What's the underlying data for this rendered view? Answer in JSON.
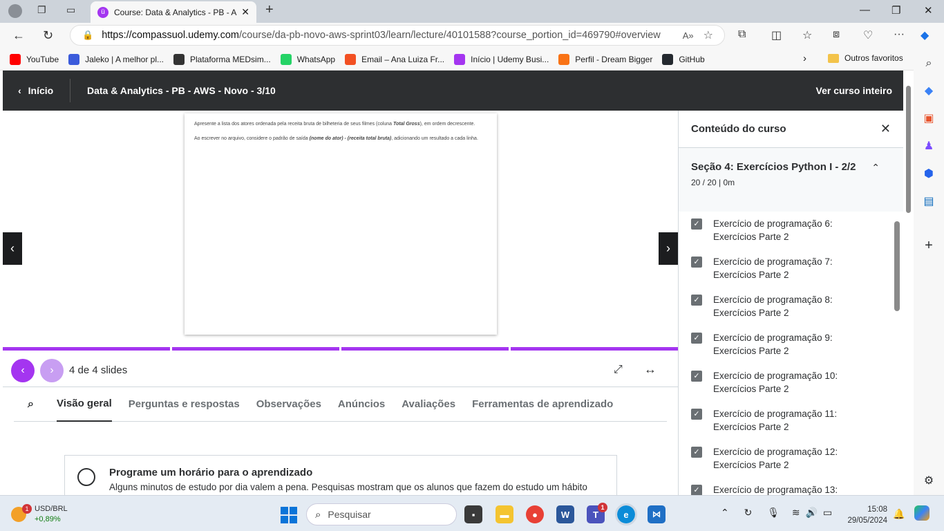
{
  "browser": {
    "tab_title": "Course: Data & Analytics - PB - A",
    "url_host": "https://compassuol.udemy.com",
    "url_path": "/course/da-pb-novo-aws-sprint03/learn/lecture/40101588?course_portion_id=469790#overview",
    "bookmarks": [
      {
        "label": "YouTube",
        "color": "#ff0000",
        "icon": "youtube-icon"
      },
      {
        "label": "Jaleko | A melhor pl...",
        "color": "#3b5bdb",
        "icon": "jaleko-icon"
      },
      {
        "label": "Plataforma MEDsim...",
        "color": "#333333",
        "icon": "location-pin-icon"
      },
      {
        "label": "WhatsApp",
        "color": "#25d366",
        "icon": "whatsapp-icon"
      },
      {
        "label": "Email – Ana Luiza Fr...",
        "color": "#f25022",
        "icon": "microsoft-icon"
      },
      {
        "label": "Início | Udemy Busi...",
        "color": "#a435f0",
        "icon": "udemy-icon"
      },
      {
        "label": "Perfil - Dream Bigger",
        "color": "#f97316",
        "icon": "dream-bigger-icon"
      },
      {
        "label": "GitHub",
        "color": "#24292f",
        "icon": "github-icon"
      }
    ],
    "other_favorites": "Outros favoritos"
  },
  "header": {
    "home": "Início",
    "title": "Data & Analytics - PB - AWS - Novo - 3/10",
    "full_course": "Ver curso inteiro"
  },
  "slide": {
    "para1_pre": "Apresente a lista dos atores ordenada pela receita bruta de bilheteria de seus filmes (coluna ",
    "para1_bold": "Total Gross",
    "para1_post": "), em ordem decrescente.",
    "para2_pre": "Ao escrever no arquivo, considere o padrão de saída ",
    "para2_bold": "(nome do ator) - (receita total bruta)",
    "para2_post": ", adicionando um resultado a cada linha.",
    "counter": "4 de 4 slides",
    "progress_segments_done": 4,
    "progress_segments_total": 4
  },
  "tabs": [
    "Visão geral",
    "Perguntas e respostas",
    "Observações",
    "Anúncios",
    "Avaliações",
    "Ferramentas de aprendizado"
  ],
  "schedule": {
    "title": "Programe um horário para o aprendizado",
    "text": "Alguns minutos de estudo por dia valem a pena. Pesquisas mostram que os alunos que fazem do estudo um hábito"
  },
  "sidebar": {
    "title": "Conteúdo do curso",
    "section_title": "Seção 4: Exercícios Python I - 2/2",
    "section_meta": "20 / 20 | 0m",
    "lectures": [
      {
        "line1": "Exercício de programação 6:",
        "line2": "Exercícios Parte 2",
        "done": true
      },
      {
        "line1": "Exercício de programação 7:",
        "line2": "Exercícios Parte 2",
        "done": true
      },
      {
        "line1": "Exercício de programação 8:",
        "line2": "Exercícios Parte 2",
        "done": true
      },
      {
        "line1": "Exercício de programação 9:",
        "line2": "Exercícios Parte 2",
        "done": true
      },
      {
        "line1": "Exercício de programação 10:",
        "line2": "Exercícios Parte 2",
        "done": true
      },
      {
        "line1": "Exercício de programação 11:",
        "line2": "Exercícios Parte 2",
        "done": true
      },
      {
        "line1": "Exercício de programação 12:",
        "line2": "Exercícios Parte 2",
        "done": true
      },
      {
        "line1": "Exercício de programação 13:",
        "line2": "",
        "done": true
      }
    ]
  },
  "taskbar": {
    "weather_label": "USD/BRL",
    "weather_change": "+0,89%",
    "weather_badge": "1",
    "search_placeholder": "Pesquisar",
    "teams_badge": "1",
    "time": "15:08",
    "date": "29/05/2024"
  },
  "colors": {
    "accent": "#a435f0",
    "header_bg": "#2d2f31"
  }
}
